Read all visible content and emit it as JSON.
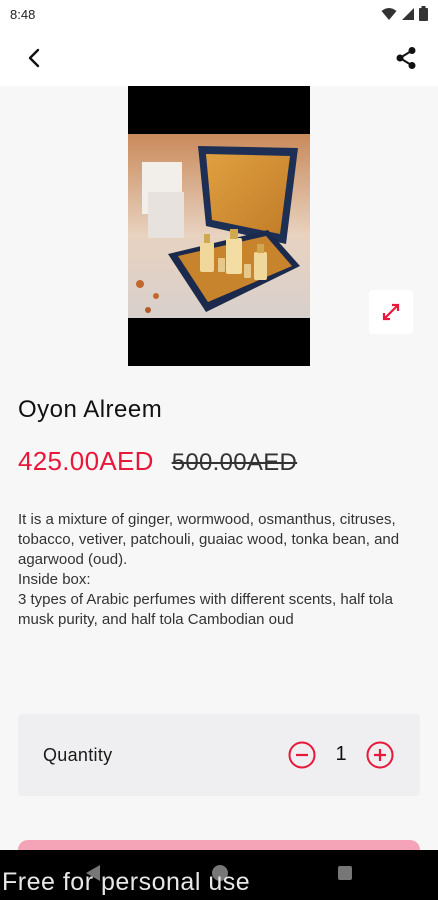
{
  "status_bar": {
    "time": "8:48",
    "icons": [
      "wifi-icon",
      "signal-icon",
      "battery-icon"
    ]
  },
  "app_bar": {
    "back_icon": "chevron-left-icon",
    "share_icon": "share-icon"
  },
  "product": {
    "name": "Oyon Alreem",
    "price_current": "425.00AED",
    "price_old": "500.00AED",
    "description": "It is a mixture of ginger, wormwood, osmanthus, citruses, tobacco, vetiver, patchouli, guaiac wood, tonka bean, and agarwood (oud).\nInside box:\n3 types of Arabic perfumes with different scents, half tola musk purity, and half tola Cambodian oud",
    "expand_icon": "expand-icon"
  },
  "quantity": {
    "label": "Quantity",
    "value": "1",
    "minus_icon": "minus-circle-icon",
    "plus_icon": "plus-circle-icon"
  },
  "watermark": "Free for personal use",
  "colors": {
    "accent": "#e8183a",
    "button_peek": "#f5a3b6",
    "background": "#f8f7f8",
    "card": "#efeef0"
  }
}
